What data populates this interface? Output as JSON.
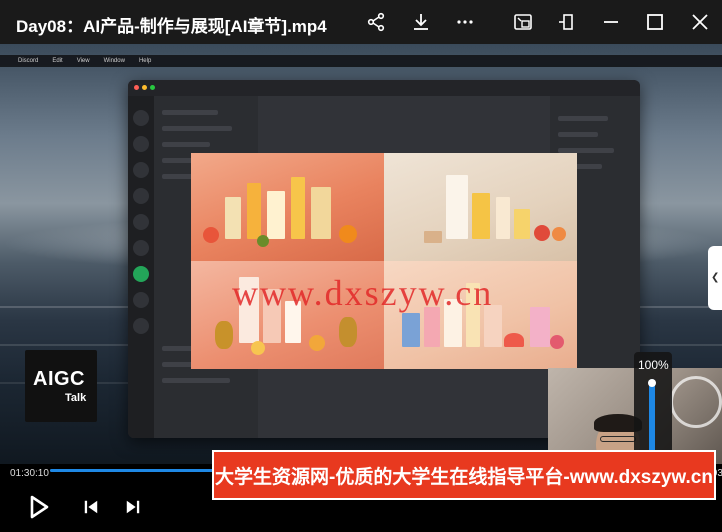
{
  "window": {
    "title": "Day08：AI产品-制作与展现[AI章节].mp4"
  },
  "toolbar": {
    "icons": [
      "share-icon",
      "download-icon",
      "more-icon",
      "picture-in-picture-icon",
      "pin-icon",
      "minimize-icon",
      "maximize-icon",
      "close-icon"
    ]
  },
  "video": {
    "mac_menu": [
      "Discord",
      "Edit",
      "View",
      "Window",
      "Help"
    ],
    "watermark": "www.dxszyw.cn",
    "logo": {
      "main": "AIGC",
      "sub": "Talk"
    },
    "volume": {
      "label": "100%",
      "level": 1.0
    }
  },
  "playback": {
    "current_time": "01:30:10",
    "total_time": "02:02:03",
    "progress": 0.739
  },
  "banner": {
    "text": "大学生资源网-优质的大学生在线指导平台-www.dxszyw.cn"
  },
  "colors": {
    "accent": "#1e88e5",
    "banner": "#e8391f",
    "watermark": "#e22828"
  }
}
